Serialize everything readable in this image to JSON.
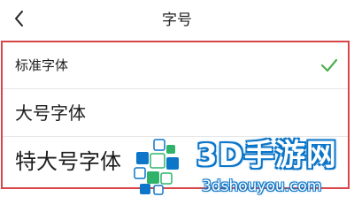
{
  "header": {
    "back_icon": "chevron-left-icon",
    "title": "字号"
  },
  "options": [
    {
      "label": "标准字体",
      "selected": true
    },
    {
      "label": "大号字体",
      "selected": false
    },
    {
      "label": "特大号字体",
      "selected": false
    }
  ],
  "selected_icon": "checkmark-icon",
  "watermark": {
    "title": "3D手游网",
    "url": "3dshouyou.com"
  },
  "colors": {
    "check": "#4caf50",
    "highlight_border": "#d8464a",
    "watermark_blue": "#0d76c8",
    "watermark_green": "#2fb36a"
  }
}
